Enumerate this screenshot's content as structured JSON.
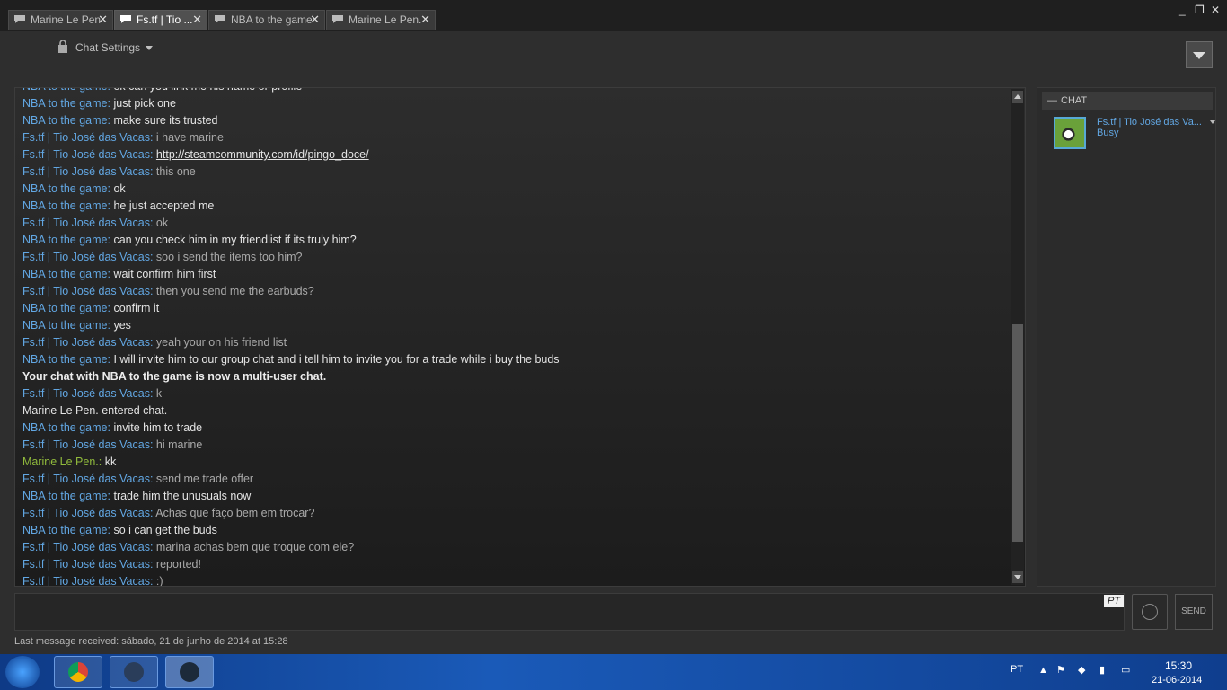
{
  "tabs": [
    {
      "label": "Marine Le Pen",
      "active": false
    },
    {
      "label": "Fs.tf | Tio ...",
      "active": true
    },
    {
      "label": "NBA to the game",
      "active": false
    },
    {
      "label": "Marine Le Pen.",
      "active": false
    }
  ],
  "window_controls": {
    "minimize": "_",
    "restore": "❐",
    "close": "✕"
  },
  "toolbar": {
    "chat_settings": "Chat Settings"
  },
  "messages": [
    {
      "kind": "msg",
      "name": "NBA to the game",
      "text": "ok can you link me his name or profile",
      "who": "nba"
    },
    {
      "kind": "msg",
      "name": "NBA to the game",
      "text": "just pick one",
      "who": "nba"
    },
    {
      "kind": "msg",
      "name": "NBA to the game",
      "text": "make sure its trusted",
      "who": "nba"
    },
    {
      "kind": "msg",
      "name": "Fs.tf | Tio José das Vacas",
      "text": "i have marine",
      "who": "fs"
    },
    {
      "kind": "link",
      "name": "Fs.tf | Tio José das Vacas",
      "text": "http://steamcommunity.com/id/pingo_doce/",
      "who": "fs"
    },
    {
      "kind": "msg",
      "name": "Fs.tf | Tio José das Vacas",
      "text": "this one",
      "who": "fs"
    },
    {
      "kind": "msg",
      "name": "NBA to the game",
      "text": "ok",
      "who": "nba"
    },
    {
      "kind": "msg",
      "name": "NBA to the game",
      "text": "he just accepted me",
      "who": "nba"
    },
    {
      "kind": "msg",
      "name": "Fs.tf | Tio José das Vacas",
      "text": "ok",
      "who": "fs"
    },
    {
      "kind": "msg",
      "name": "NBA to the game",
      "text": "can you check him in my friendlist if its truly him?",
      "who": "nba"
    },
    {
      "kind": "msg",
      "name": "Fs.tf | Tio José das Vacas",
      "text": "soo i send the items too him?",
      "who": "fs"
    },
    {
      "kind": "msg",
      "name": "NBA to the game",
      "text": "wait confirm him first",
      "who": "nba"
    },
    {
      "kind": "msg",
      "name": "Fs.tf | Tio José das Vacas",
      "text": "then you send me the earbuds?",
      "who": "fs"
    },
    {
      "kind": "msg",
      "name": "NBA to the game",
      "text": "confirm it",
      "who": "nba"
    },
    {
      "kind": "msg",
      "name": "NBA to the game",
      "text": "yes",
      "who": "nba"
    },
    {
      "kind": "msg",
      "name": "Fs.tf | Tio José das Vacas",
      "text": "yeah your on his friend list",
      "who": "fs"
    },
    {
      "kind": "msg",
      "name": "NBA to the game",
      "text": "I will invite him to our group chat and i tell him to invite you for a trade while i buy the buds",
      "who": "nba"
    },
    {
      "kind": "bold",
      "name": "",
      "text": "Your chat with NBA to the game is now a multi-user chat.",
      "who": "sys"
    },
    {
      "kind": "msg",
      "name": "Fs.tf | Tio José das Vacas",
      "text": "k",
      "who": "fs"
    },
    {
      "kind": "sys",
      "name": "",
      "text": "Marine Le Pen. entered chat.",
      "who": "sys"
    },
    {
      "kind": "msg",
      "name": "NBA to the game",
      "text": "invite him to trade",
      "who": "nba"
    },
    {
      "kind": "msg",
      "name": "Fs.tf | Tio José das Vacas",
      "text": "hi marine",
      "who": "fs"
    },
    {
      "kind": "msg",
      "name": "Marine Le Pen.",
      "text": "kk",
      "who": "mar"
    },
    {
      "kind": "msg",
      "name": "Fs.tf | Tio José das Vacas",
      "text": "send me trade offer",
      "who": "fs"
    },
    {
      "kind": "msg",
      "name": "NBA to the game",
      "text": "trade him the unusuals now",
      "who": "nba"
    },
    {
      "kind": "msg",
      "name": "Fs.tf | Tio José das Vacas",
      "text": "Achas que faço bem em trocar?",
      "who": "fs"
    },
    {
      "kind": "msg",
      "name": "NBA to the game",
      "text": "so i can get the buds",
      "who": "nba"
    },
    {
      "kind": "msg",
      "name": "Fs.tf | Tio José das Vacas",
      "text": "marina achas bem que troque com ele?",
      "who": "fs"
    },
    {
      "kind": "msg",
      "name": "Fs.tf | Tio José das Vacas",
      "text": "reported!",
      "who": "fs"
    },
    {
      "kind": "msg",
      "name": "Fs.tf | Tio José das Vacas",
      "text": ":)",
      "who": "fs"
    }
  ],
  "sidebar": {
    "header": "CHAT",
    "friend_name": "Fs.tf | Tio José das Va...",
    "friend_status": "Busy"
  },
  "input": {
    "language_badge": "PT",
    "send_label": "SEND"
  },
  "status_line": "Last message received: sábado, 21 de junho de 2014 at 15:28",
  "taskbar": {
    "lang": "PT",
    "time": "15:30",
    "date": "21-06-2014"
  }
}
